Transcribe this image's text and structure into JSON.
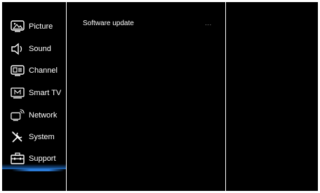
{
  "menu": {
    "items": [
      {
        "label": "Picture",
        "icon": "picture-icon"
      },
      {
        "label": "Sound",
        "icon": "speaker-icon"
      },
      {
        "label": "Channel",
        "icon": "channel-icon"
      },
      {
        "label": "Smart TV",
        "icon": "smart-tv-icon"
      },
      {
        "label": "Network",
        "icon": "network-icon"
      },
      {
        "label": "System",
        "icon": "tools-icon"
      },
      {
        "label": "Support",
        "icon": "toolbox-icon"
      }
    ],
    "selected": "Support"
  },
  "submenu": {
    "items": [
      {
        "label": "Software update",
        "value": "..."
      }
    ]
  }
}
